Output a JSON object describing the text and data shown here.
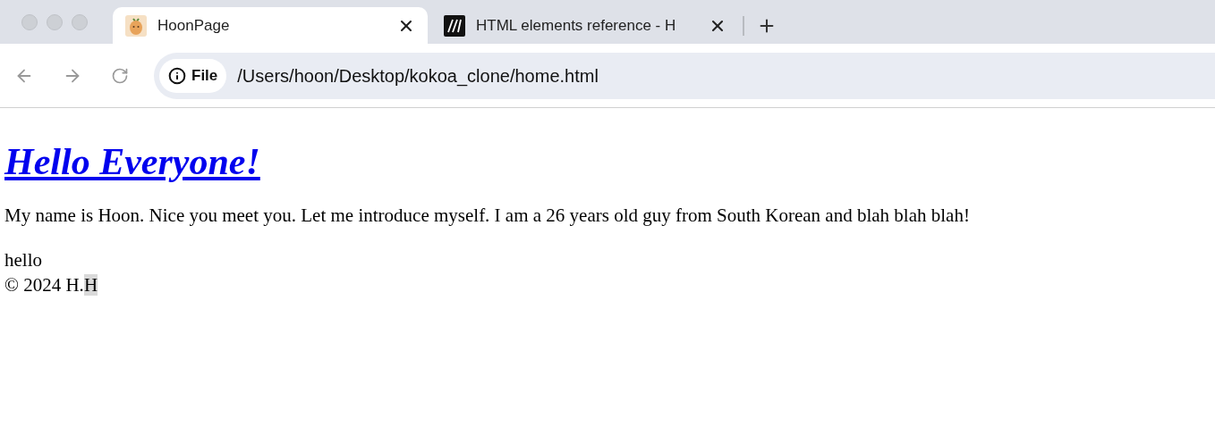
{
  "tabs": [
    {
      "title": "HoonPage",
      "selected": true,
      "kind": "fruit"
    },
    {
      "title": "HTML elements reference - H",
      "selected": false,
      "kind": "mdn"
    }
  ],
  "address_bar": {
    "badge": "File",
    "url": "/Users/hoon/Desktop/kokoa_clone/home.html"
  },
  "page": {
    "heading": "Hello Everyone!",
    "paragraph": "My name is Hoon. Nice you meet you. Let me introduce myself. I am a 26 years old guy from South Korean and blah blah blah!",
    "lines": [
      "hello"
    ],
    "footer": {
      "text": "© 2024 H.",
      "selected_text": "H"
    }
  }
}
